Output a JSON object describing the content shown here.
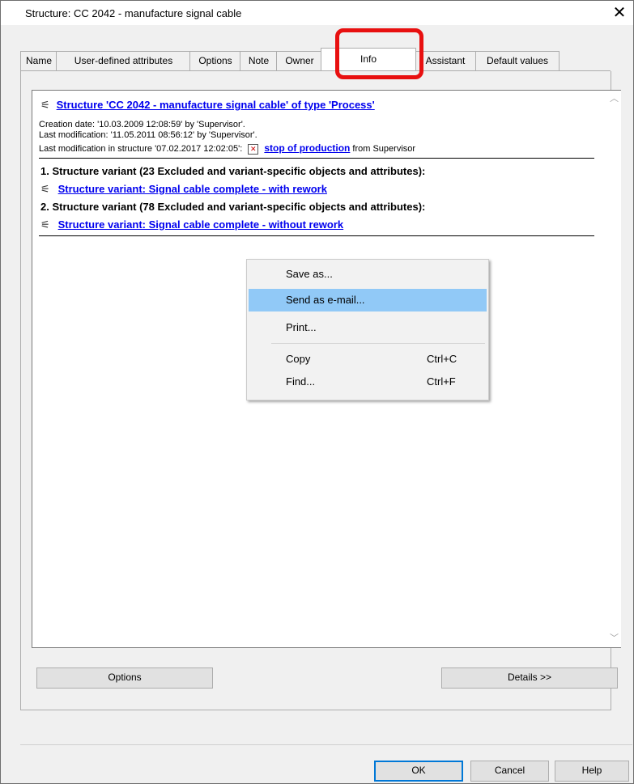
{
  "window": {
    "title": "Structure: CC 2042 - manufacture signal cable",
    "close_glyph": "✕"
  },
  "tabs": [
    {
      "label": "Name"
    },
    {
      "label": "User-defined attributes"
    },
    {
      "label": "Options"
    },
    {
      "label": "Note"
    },
    {
      "label": "Owner"
    },
    {
      "label": "Info"
    },
    {
      "label": "Assistant"
    },
    {
      "label": "Default values"
    }
  ],
  "active_tab": "Info",
  "info": {
    "structure_link": "Structure 'CC 2042 - manufacture signal cable' of type 'Process'",
    "creation": "Creation date: '10.03.2009 12:08:59' by 'Supervisor'.",
    "last_mod": "Last modification: '11.05.2011 08:56:12' by 'Supervisor'.",
    "last_mod_structure_prefix": "Last modification in structure  '07.02.2017 12:02:05':",
    "last_mod_structure_link": "stop of production",
    "last_mod_structure_suffix": " from Supervisor",
    "variant1_heading": "1. Structure variant (23 Excluded and variant-specific objects and attributes):",
    "variant1_link": "Structure variant: Signal cable complete - with rework",
    "variant2_heading": "2. Structure variant (78 Excluded and variant-specific objects and attributes):",
    "variant2_link": "Structure variant: Signal cable complete - without rework"
  },
  "context_menu": {
    "items": [
      {
        "label": "Save as...",
        "shortcut": ""
      },
      {
        "label": "Send as e-mail...",
        "shortcut": ""
      },
      {
        "label": "Print...",
        "shortcut": ""
      },
      {
        "label": "Copy",
        "shortcut": "Ctrl+C"
      },
      {
        "label": "Find...",
        "shortcut": "Ctrl+F"
      }
    ],
    "highlighted": "Send as e-mail..."
  },
  "buttons": {
    "options": "Options",
    "details": "Details >>",
    "ok": "OK",
    "cancel": "Cancel",
    "help": "Help"
  },
  "colors": {
    "link": "#0000ee",
    "menu_highlight": "#91c9f7",
    "annotation": "#e81010"
  }
}
